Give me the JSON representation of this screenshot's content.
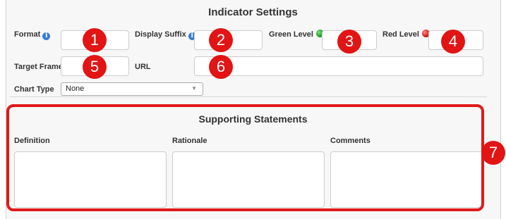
{
  "header": {
    "title": "Indicator Settings"
  },
  "fields": {
    "format_label": "Format",
    "display_suffix_label": "Display Suffix",
    "green_level_label": "Green Level",
    "red_level_label": "Red Level",
    "target_frame_label": "Target Frame",
    "url_label": "URL",
    "chart_type_label": "Chart Type",
    "chart_type_value": "None"
  },
  "icons": {
    "info_glyph": "i",
    "select_arrow": "▼"
  },
  "supporting": {
    "title": "Supporting Statements",
    "definition_label": "Definition",
    "rationale_label": "Rationale",
    "comments_label": "Comments"
  },
  "callouts": [
    "1",
    "2",
    "3",
    "4",
    "5",
    "6",
    "7"
  ],
  "colors": {
    "callout": "#e21414",
    "highlight_border": "#e01a1a",
    "info_icon": "#3a7bd5",
    "green_level": "#1e9e2a",
    "red_level": "#d11a1a"
  }
}
